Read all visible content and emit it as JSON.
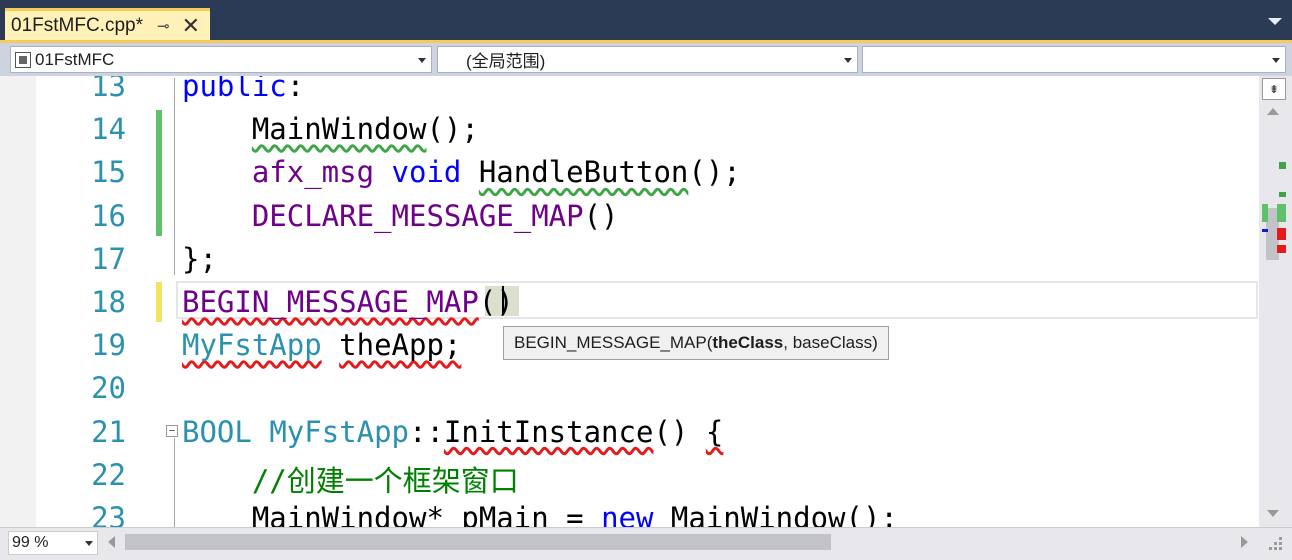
{
  "tab": {
    "title": "01FstMFC.cpp*",
    "pin_glyph": "⊸",
    "close_glyph": "✕"
  },
  "nav": {
    "project": "01FstMFC",
    "scope": "(全局范围)",
    "member": ""
  },
  "lines": [
    {
      "n": "13",
      "tokens": [
        {
          "t": "public",
          "c": "kw"
        },
        {
          "t": ":",
          "c": ""
        }
      ]
    },
    {
      "n": "14",
      "tokens": [
        {
          "t": "    ",
          "c": ""
        },
        {
          "t": "MainWindow",
          "c": "sqg"
        },
        {
          "t": "();",
          "c": ""
        }
      ]
    },
    {
      "n": "15",
      "tokens": [
        {
          "t": "    ",
          "c": ""
        },
        {
          "t": "afx_msg",
          "c": "mac"
        },
        {
          "t": " ",
          "c": ""
        },
        {
          "t": "void",
          "c": "kw"
        },
        {
          "t": " ",
          "c": ""
        },
        {
          "t": "HandleButton",
          "c": "sqg"
        },
        {
          "t": "();",
          "c": ""
        }
      ]
    },
    {
      "n": "16",
      "tokens": [
        {
          "t": "    ",
          "c": ""
        },
        {
          "t": "DECLARE_MESSAGE_MAP",
          "c": "mac"
        },
        {
          "t": "()",
          "c": ""
        }
      ]
    },
    {
      "n": "17",
      "tokens": [
        {
          "t": "};",
          "c": ""
        }
      ]
    },
    {
      "n": "18",
      "tokens": [
        {
          "t": "BEGIN_MESSAGE_MAP",
          "c": "mac sq"
        },
        {
          "t": "()",
          "c": ""
        }
      ]
    },
    {
      "n": "19",
      "tokens": [
        {
          "t": "MyFstApp",
          "c": "ty sq"
        },
        {
          "t": " ",
          "c": ""
        },
        {
          "t": "theApp;",
          "c": "sq"
        }
      ]
    },
    {
      "n": "20",
      "tokens": []
    },
    {
      "n": "21",
      "tokens": [
        {
          "t": "BOOL",
          "c": "ty"
        },
        {
          "t": " ",
          "c": ""
        },
        {
          "t": "MyFstApp",
          "c": "ty"
        },
        {
          "t": "::",
          "c": ""
        },
        {
          "t": "InitInstance",
          "c": "sq"
        },
        {
          "t": "() ",
          "c": ""
        },
        {
          "t": "{",
          "c": "sq"
        }
      ]
    },
    {
      "n": "22",
      "tokens": [
        {
          "t": "    ",
          "c": ""
        },
        {
          "t": "//创建一个框架窗口",
          "c": "cm"
        }
      ]
    },
    {
      "n": "23",
      "tokens": [
        {
          "t": "    ",
          "c": ""
        },
        {
          "t": "MainWindow",
          "c": ""
        },
        {
          "t": "* pMain = ",
          "c": ""
        },
        {
          "t": "new",
          "c": "kw"
        },
        {
          "t": " MainWindow();",
          "c": ""
        }
      ]
    }
  ],
  "tooltip": {
    "prefix": "BEGIN_MESSAGE_MAP(",
    "bold": "theClass",
    "suffix": ", baseClass)"
  },
  "zoom": "99 %",
  "colors": {
    "changed": "#5fc16a",
    "unsaved": "#f4e361",
    "error": "#e51a1a",
    "keyword": "#0000ff",
    "type": "#2b91af",
    "macro": "#6f008a",
    "comment": "#008000"
  }
}
